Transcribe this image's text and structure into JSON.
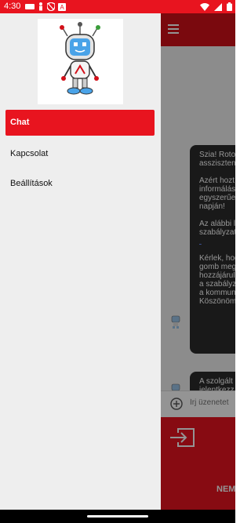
{
  "status_bar": {
    "time": "4:30"
  },
  "drawer": {
    "items": [
      {
        "label": "Chat",
        "active": true
      },
      {
        "label": "Kapcsolat",
        "active": false
      },
      {
        "label": "Beállítások",
        "active": false
      }
    ]
  },
  "chat": {
    "messages": [
      {
        "paragraphs": [
          "Szia!  Roto",
          "asszisztens",
          "Azért hozt",
          "informálás",
          "egyszerűe",
          "napján!",
          "Az alábbi l",
          "szabályzat",
          "Kérlek, hog",
          "gomb meg",
          "hozzájárul",
          "a szabályz",
          "a kommun",
          "Köszönöm"
        ]
      },
      {
        "paragraphs": [
          "A szolgált",
          "jelentkezz"
        ]
      }
    ],
    "input_placeholder": "Írj üzenetet"
  },
  "bottom_button": {
    "label": "NEM"
  },
  "colors": {
    "primary_red": "#e8141f",
    "dark_red": "#d31019",
    "bubble_dark": "#2b2b2b"
  }
}
